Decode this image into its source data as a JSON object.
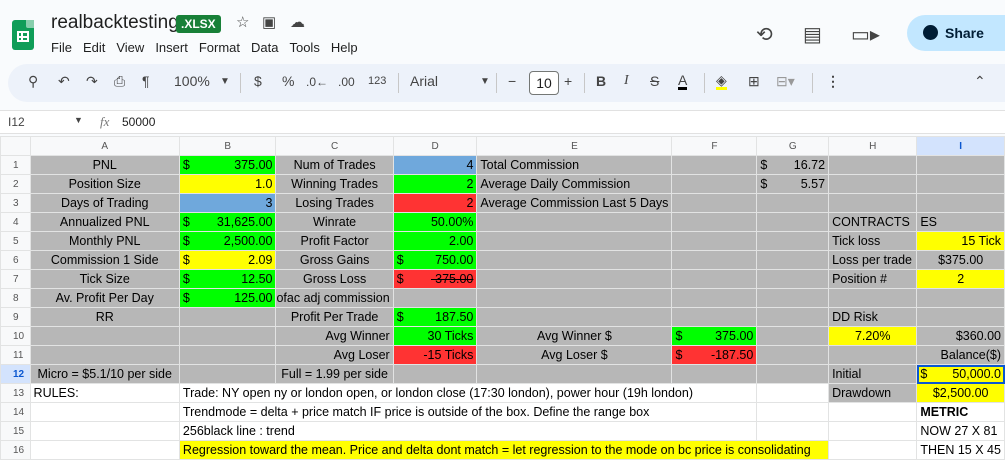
{
  "app": {
    "doc_title": "realbacktesting",
    "badge": ".XLSX",
    "menu": [
      "File",
      "Edit",
      "View",
      "Insert",
      "Format",
      "Data",
      "Tools",
      "Help"
    ],
    "share_label": "Share"
  },
  "toolbar": {
    "zoom": "100%",
    "currency": "$",
    "percent": "%",
    "dec_less": ".0←",
    "dec_more": ".00",
    "number_format": "123",
    "font": "Arial",
    "font_size": "10"
  },
  "formula_bar": {
    "name_box": "I12",
    "fx": "fx",
    "value": "50000"
  },
  "columns": [
    "A",
    "B",
    "C",
    "D",
    "E",
    "F",
    "G",
    "H",
    "I"
  ],
  "rows": {
    "r1": {
      "n": "1",
      "a": "PNL",
      "b_cur": "$",
      "b": "375.00",
      "c": "Num of Trades",
      "d": "4",
      "e": "Total Commission",
      "g_cur": "$",
      "g": "16.72"
    },
    "r2": {
      "n": "2",
      "a": "Position Size",
      "b": "1.0",
      "c": "Winning Trades",
      "d": "2",
      "e": "Average Daily Commission",
      "g_cur": "$",
      "g": "5.57"
    },
    "r3": {
      "n": "3",
      "a": "Days of Trading",
      "b": "3",
      "c": "Losing Trades",
      "d": "2",
      "e": "Average Commission Last 5 Days"
    },
    "r4": {
      "n": "4",
      "a": "Annualized PNL",
      "b_cur": "$",
      "b": "31,625.00",
      "c": "Winrate",
      "d": "50.00%",
      "h": "CONTRACTS",
      "i": "ES"
    },
    "r5": {
      "n": "5",
      "a": "Monthly PNL",
      "b_cur": "$",
      "b": "2,500.00",
      "c": "Profit Factor",
      "d": "2.00",
      "h": "Tick loss",
      "i": "15 Tick"
    },
    "r6": {
      "n": "6",
      "a": "Commission 1 Side",
      "b_cur": "$",
      "b": "2.09",
      "c": "Gross Gains",
      "d_cur": "$",
      "d": "750.00",
      "h": "Loss per trade",
      "i": "$375.00"
    },
    "r7": {
      "n": "7",
      "a": "Tick Size",
      "b_cur": "$",
      "b": "12.50",
      "c": "Gross Loss",
      "d_cur": "$",
      "d": "-375.00",
      "h": "Position #",
      "i": "2"
    },
    "r8": {
      "n": "8",
      "a": "Av. Profit Per Day",
      "b_cur": "$",
      "b": "125.00",
      "c": "ofac adj commission"
    },
    "r9": {
      "n": "9",
      "a": "RR",
      "c": "Profit Per Trade",
      "d_cur": "$",
      "d": "187.50",
      "h": "DD Risk"
    },
    "r10": {
      "n": "10",
      "c": "Avg Winner",
      "d": "30 Ticks",
      "e": "Avg Winner $",
      "f_cur": "$",
      "f": "375.00",
      "h": "7.20%",
      "i": "$360.00"
    },
    "r11": {
      "n": "11",
      "c": "Avg Loser",
      "d": "-15 Ticks",
      "e": "Avg Loser $",
      "f_cur": "$",
      "f": "-187.50",
      "i": "Balance($)"
    },
    "r12": {
      "n": "12",
      "a": "Micro = $5.1/10 per side",
      "c": "Full = 1.99 per side",
      "h": "Initial",
      "i_cur": "$",
      "i": "50,000.0"
    },
    "r13": {
      "n": "13",
      "a": "RULES:",
      "b": "Trade: NY open ny or london open, or  london close (17:30 london), power hour (19h london)",
      "h": "Drawdown",
      "i": "$2,500.00"
    },
    "r14": {
      "n": "14",
      "b": "Trendmode = delta + price match IF price is outside of the box. Define the range box",
      "i": "METRIC"
    },
    "r15": {
      "n": "15",
      "b": "256black line : trend",
      "i": "NOW 27 X 81"
    },
    "r16": {
      "n": "16",
      "b": "Regression toward the mean. Price and delta dont match = let regression to the mode on bc price is consolidating",
      "i": "THEN 15 X 45"
    }
  },
  "colors": {
    "green": "#00ff00",
    "yellow": "#ffff00",
    "blue": "#6fa8dc",
    "red": "#ff3333",
    "grey": "#b7b7b7"
  }
}
